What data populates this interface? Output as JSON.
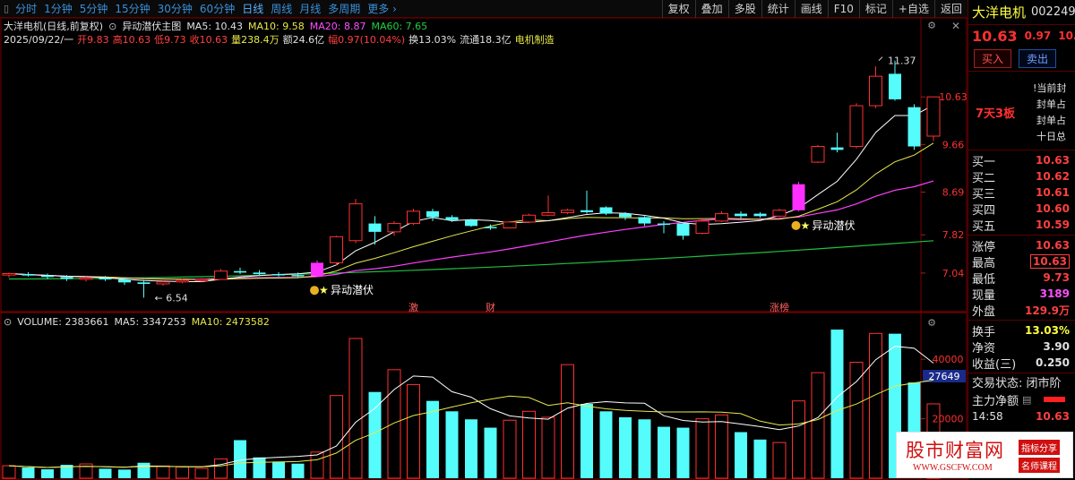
{
  "toolbar": {
    "periods": [
      "分时",
      "1分钟",
      "5分钟",
      "15分钟",
      "30分钟",
      "60分钟",
      "日线",
      "周线",
      "月线",
      "多周期",
      "更多"
    ],
    "right_buttons": [
      "复权",
      "叠加",
      "多股",
      "统计",
      "画线",
      "F10",
      "标记",
      "+自选",
      "返回"
    ]
  },
  "title": {
    "stock": "大洋电机(日线,前复权)",
    "indicator": "异动潜伏主图",
    "ma5": "MA5: 10.43",
    "ma10": "MA10: 9.58",
    "ma20": "MA20: 8.87",
    "ma60": "MA60: 7.65"
  },
  "info": {
    "date": "2025/09/22/一",
    "open": "开9.83",
    "high": "高10.63",
    "low": "低9.73",
    "close": "收10.63",
    "volume": "量238.4万",
    "amount": "额24.6亿",
    "change": "幅0.97(10.04%)",
    "turnover": "换13.03%",
    "float": "流通18.3亿",
    "sector": "电机制造"
  },
  "volume_title": {
    "vol": "VOLUME: 2383661",
    "ma5": "MA5: 3347253",
    "ma10": "MA10: 2473582"
  },
  "price_axis": [
    "10.63",
    "9.66",
    "8.69",
    "7.82",
    "7.04"
  ],
  "volume_axis": [
    "40000",
    "20000"
  ],
  "volume_marker": "27649",
  "annotations": {
    "high": "11.37",
    "low": "6.54",
    "signal1": "异动潜伏",
    "signal2": "异动潜伏",
    "tag1": "激",
    "tag2": "财",
    "tag3": "涨榜"
  },
  "colors": {
    "up": "#ff3030",
    "down": "#54fcfc",
    "ma5": "#ffffff",
    "ma10": "#e8e84a",
    "ma20": "#ff40ff",
    "ma60": "#20c040"
  },
  "chart_data": {
    "type": "candlestick",
    "candles": [
      {
        "o": 7.0,
        "h": 7.05,
        "l": 6.95,
        "c": 7.03
      },
      {
        "o": 7.02,
        "h": 7.06,
        "l": 6.97,
        "c": 6.99
      },
      {
        "o": 6.99,
        "h": 7.03,
        "l": 6.92,
        "c": 6.96
      },
      {
        "o": 6.96,
        "h": 7.0,
        "l": 6.88,
        "c": 6.92
      },
      {
        "o": 6.92,
        "h": 6.97,
        "l": 6.87,
        "c": 6.94
      },
      {
        "o": 6.94,
        "h": 6.98,
        "l": 6.88,
        "c": 6.91
      },
      {
        "o": 6.91,
        "h": 6.95,
        "l": 6.8,
        "c": 6.85
      },
      {
        "o": 6.85,
        "h": 6.9,
        "l": 6.54,
        "c": 6.82
      },
      {
        "o": 6.82,
        "h": 6.88,
        "l": 6.78,
        "c": 6.86
      },
      {
        "o": 6.86,
        "h": 6.92,
        "l": 6.83,
        "c": 6.89
      },
      {
        "o": 6.89,
        "h": 6.94,
        "l": 6.85,
        "c": 6.91
      },
      {
        "o": 6.91,
        "h": 7.12,
        "l": 6.9,
        "c": 7.08
      },
      {
        "o": 7.08,
        "h": 7.15,
        "l": 7.02,
        "c": 7.05
      },
      {
        "o": 7.05,
        "h": 7.1,
        "l": 6.98,
        "c": 7.02
      },
      {
        "o": 7.02,
        "h": 7.06,
        "l": 6.97,
        "c": 7.0
      },
      {
        "o": 7.0,
        "h": 7.05,
        "l": 6.95,
        "c": 6.98
      },
      {
        "o": 6.98,
        "h": 7.3,
        "l": 6.96,
        "c": 7.25
      },
      {
        "o": 7.25,
        "h": 7.8,
        "l": 7.2,
        "c": 7.78
      },
      {
        "o": 7.7,
        "h": 8.55,
        "l": 7.65,
        "c": 8.45
      },
      {
        "o": 8.05,
        "h": 8.2,
        "l": 7.62,
        "c": 7.88
      },
      {
        "o": 7.88,
        "h": 8.1,
        "l": 7.8,
        "c": 8.05
      },
      {
        "o": 8.05,
        "h": 8.35,
        "l": 8.02,
        "c": 8.3
      },
      {
        "o": 8.3,
        "h": 8.35,
        "l": 8.1,
        "c": 8.18
      },
      {
        "o": 8.18,
        "h": 8.22,
        "l": 8.08,
        "c": 8.12
      },
      {
        "o": 8.12,
        "h": 8.14,
        "l": 7.98,
        "c": 8.0
      },
      {
        "o": 7.98,
        "h": 8.03,
        "l": 7.92,
        "c": 7.96
      },
      {
        "o": 7.96,
        "h": 8.1,
        "l": 7.95,
        "c": 8.08
      },
      {
        "o": 8.08,
        "h": 8.25,
        "l": 8.06,
        "c": 8.22
      },
      {
        "o": 8.22,
        "h": 8.62,
        "l": 8.2,
        "c": 8.27
      },
      {
        "o": 8.27,
        "h": 8.35,
        "l": 8.24,
        "c": 8.32
      },
      {
        "o": 8.32,
        "h": 8.72,
        "l": 8.25,
        "c": 8.28
      },
      {
        "o": 8.38,
        "h": 8.4,
        "l": 8.22,
        "c": 8.25
      },
      {
        "o": 8.25,
        "h": 8.28,
        "l": 8.12,
        "c": 8.18
      },
      {
        "o": 8.18,
        "h": 8.2,
        "l": 8.0,
        "c": 8.05
      },
      {
        "o": 8.05,
        "h": 8.1,
        "l": 7.85,
        "c": 8.03
      },
      {
        "o": 8.05,
        "h": 8.07,
        "l": 7.72,
        "c": 7.8
      },
      {
        "o": 7.85,
        "h": 8.15,
        "l": 7.83,
        "c": 8.1
      },
      {
        "o": 8.1,
        "h": 8.3,
        "l": 8.08,
        "c": 8.25
      },
      {
        "o": 8.25,
        "h": 8.3,
        "l": 8.15,
        "c": 8.2
      },
      {
        "o": 8.25,
        "h": 8.28,
        "l": 8.17,
        "c": 8.2
      },
      {
        "o": 8.2,
        "h": 8.35,
        "l": 8.18,
        "c": 8.32
      },
      {
        "o": 8.32,
        "h": 8.9,
        "l": 8.3,
        "c": 8.85
      },
      {
        "o": 9.3,
        "h": 9.65,
        "l": 9.28,
        "c": 9.62
      },
      {
        "o": 9.6,
        "h": 9.9,
        "l": 9.5,
        "c": 9.55
      },
      {
        "o": 9.62,
        "h": 10.5,
        "l": 9.58,
        "c": 10.45
      },
      {
        "o": 10.45,
        "h": 11.25,
        "l": 10.4,
        "c": 11.05
      },
      {
        "o": 11.1,
        "h": 11.37,
        "l": 10.55,
        "c": 10.58
      },
      {
        "o": 10.42,
        "h": 10.48,
        "l": 9.55,
        "c": 9.62
      },
      {
        "o": 9.83,
        "h": 10.63,
        "l": 9.73,
        "c": 10.63
      }
    ],
    "volumes": [
      4200,
      3600,
      3000,
      4500,
      4800,
      3200,
      2900,
      5200,
      4100,
      3800,
      3300,
      6500,
      12800,
      7000,
      5600,
      4900,
      8800,
      27800,
      47000,
      29000,
      36500,
      31500,
      26000,
      22500,
      19800,
      17000,
      19500,
      22500,
      20500,
      38200,
      25000,
      22500,
      20500,
      19800,
      17300,
      17000,
      20000,
      21300,
      15500,
      13000,
      12000,
      26000,
      35500,
      50000,
      39000,
      48700,
      48600,
      32200,
      25000
    ],
    "ylim": [
      6.4,
      11.6
    ],
    "volume_ylim": [
      0,
      50000
    ]
  },
  "panel": {
    "name": "大洋电机",
    "code": "002249",
    "price": "10.63",
    "change": "0.97",
    "pct": "10.04%",
    "buy_label": "买入",
    "sell_label": "卖出",
    "streak": "7天3板",
    "limit_lines": [
      "当前封",
      "封单占",
      "封单占",
      "十日总"
    ],
    "bids": [
      {
        "k": "买一",
        "v": "10.63"
      },
      {
        "k": "买二",
        "v": "10.62"
      },
      {
        "k": "买三",
        "v": "10.61"
      },
      {
        "k": "买四",
        "v": "10.60"
      },
      {
        "k": "买五",
        "v": "10.59"
      }
    ],
    "stats1": [
      {
        "k": "涨停",
        "v": "10.63"
      },
      {
        "k": "最高",
        "v": "10.63"
      },
      {
        "k": "最低",
        "v": "9.73"
      },
      {
        "k": "现量",
        "v": "3189"
      },
      {
        "k": "外盘",
        "v": "129.9万"
      }
    ],
    "stats2": [
      {
        "k": "换手",
        "v": "13.03%"
      },
      {
        "k": "净资",
        "v": "3.90"
      },
      {
        "k": "收益(三)",
        "v": "0.250"
      }
    ],
    "status": "交易状态: 闭市阶",
    "main_fund": "主力净额",
    "tick_time": "14:58",
    "tick_price": "10.63"
  },
  "watermark": {
    "main": "股市财富网",
    "url": "WWW.GSCFW.COM",
    "tag1": "指标分享",
    "tag2": "名师课程"
  }
}
